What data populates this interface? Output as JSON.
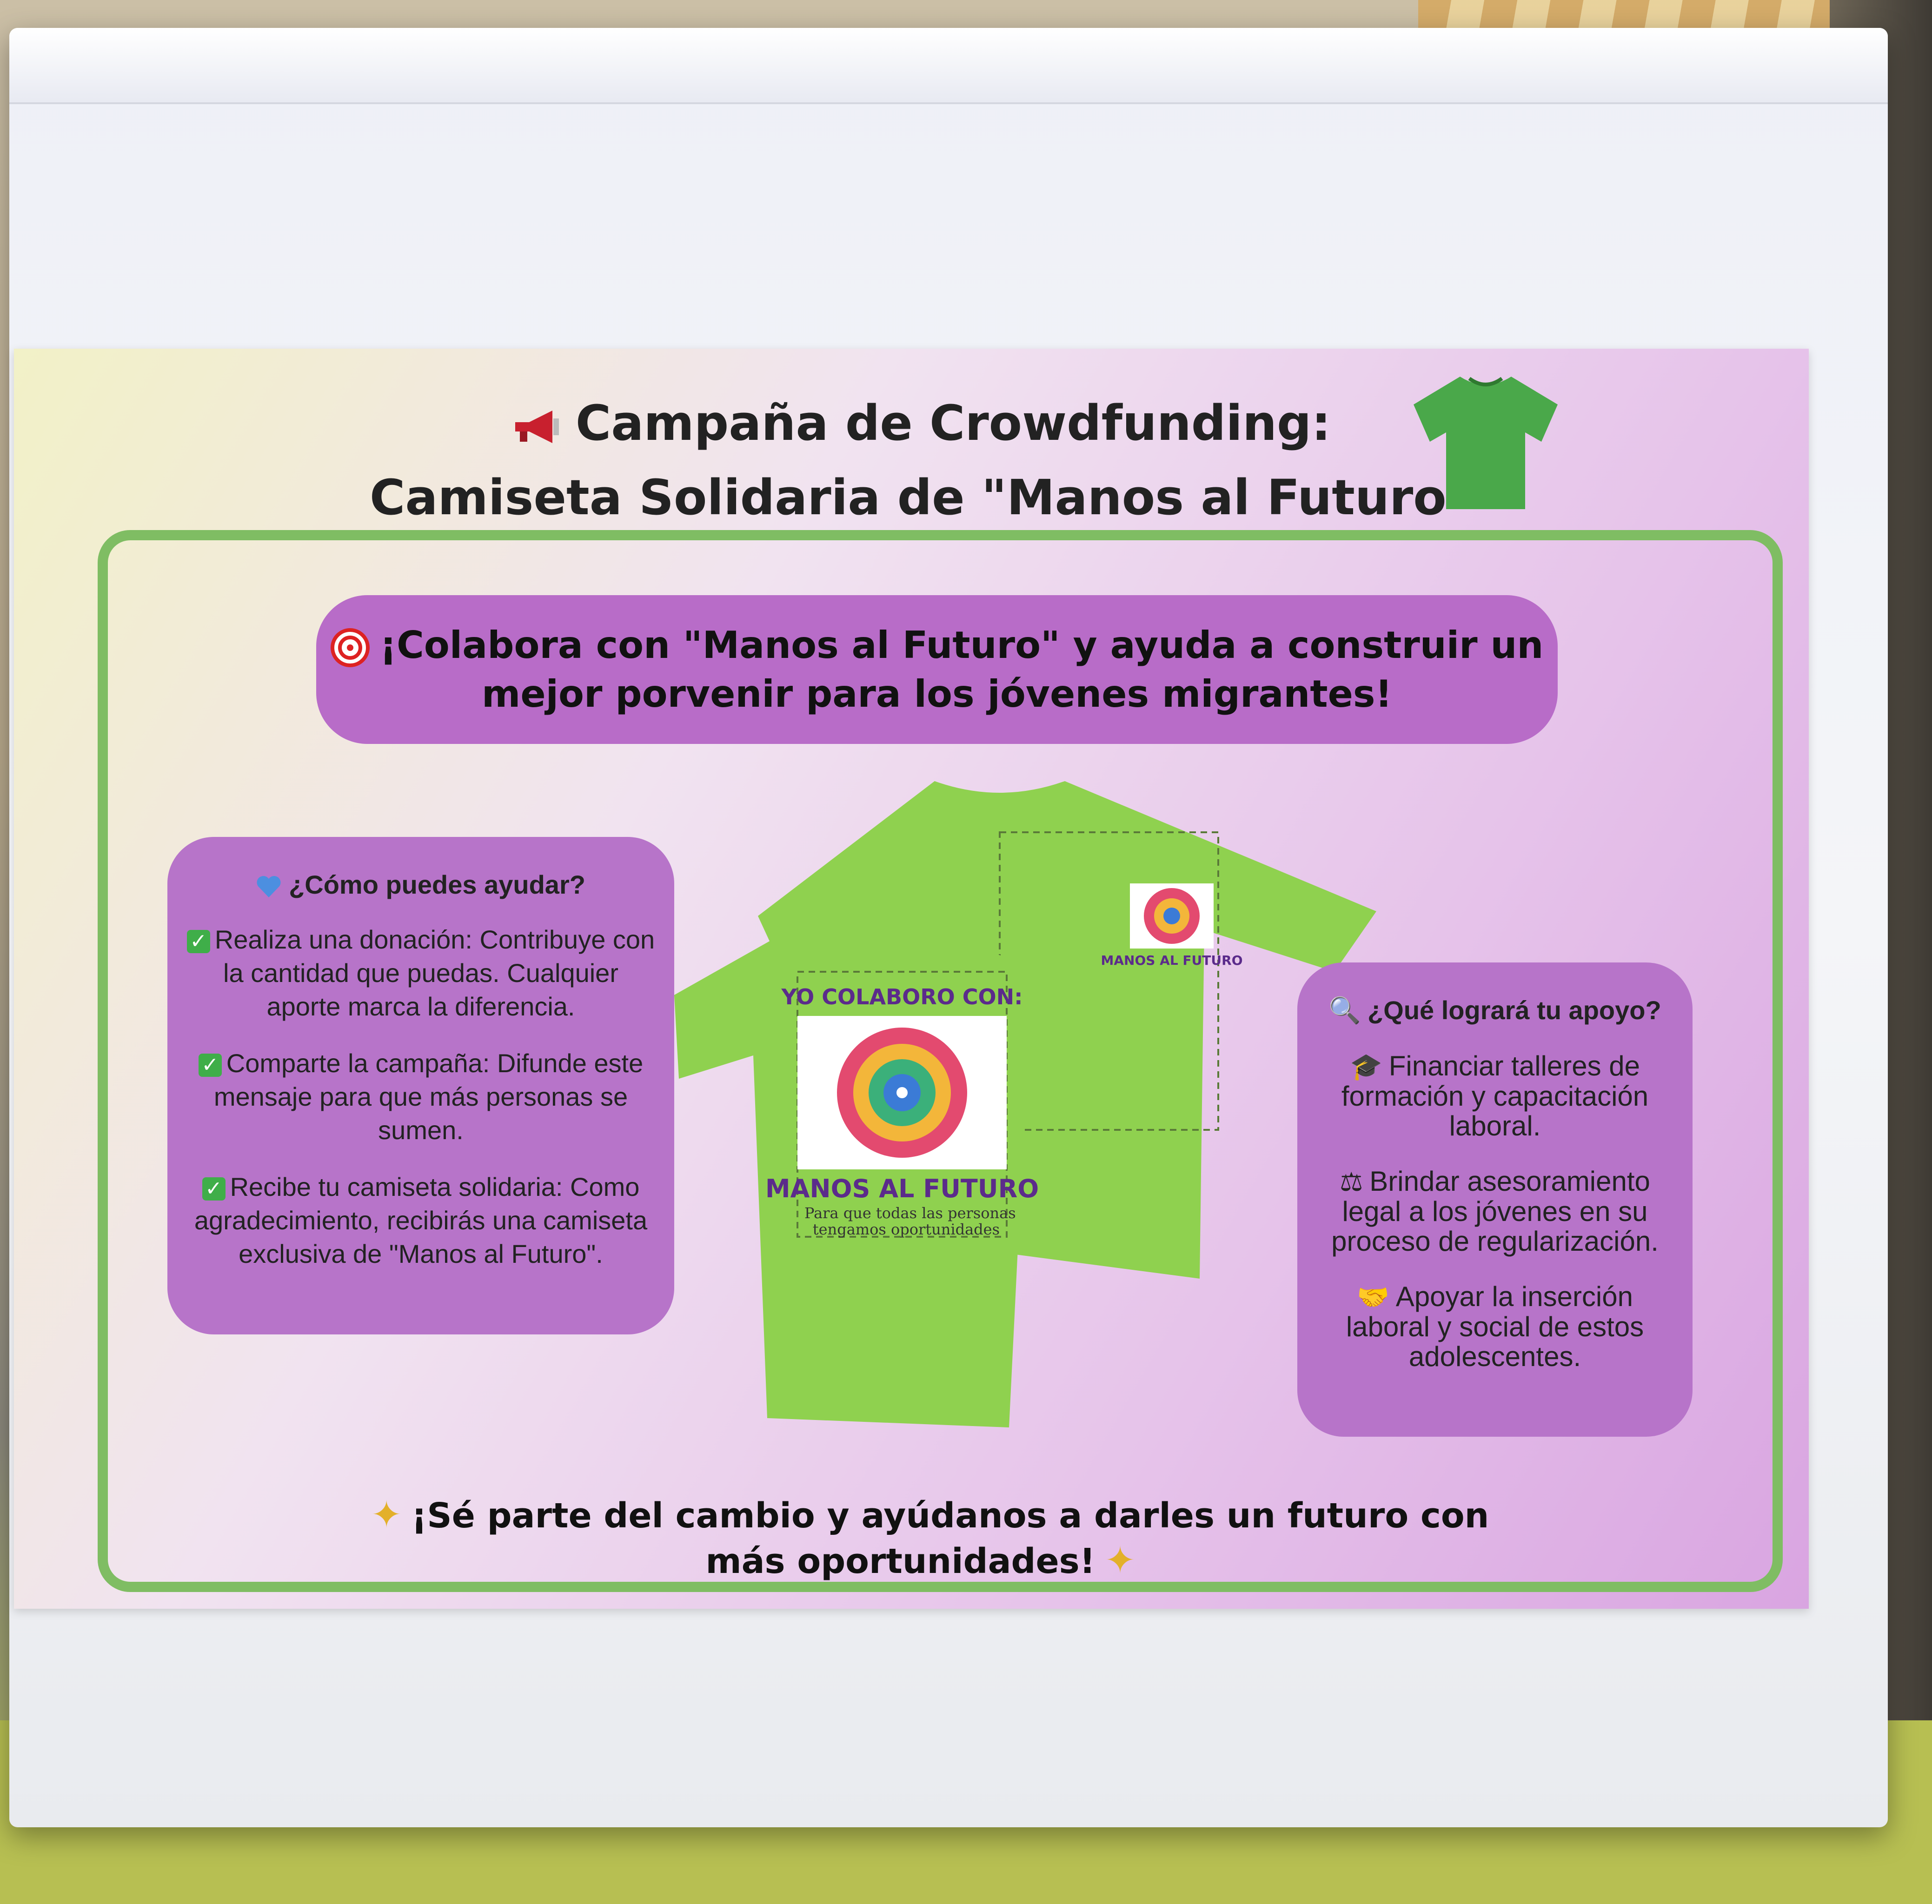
{
  "poster": {
    "title_line1": "Campaña de Crowdfunding:",
    "title_line2": "Camiseta Solidaria de \"Manos al Futuro\"",
    "banner_line1": "¡Colabora con \"Manos al Futuro\" y ayuda a construir un",
    "banner_line2": "mejor porvenir para los jóvenes migrantes!",
    "help_card": {
      "title": "¿Cómo puedes ayudar?",
      "items": [
        "Realiza una donación: Contribuye con la cantidad que puedas. Cualquier aporte marca la diferencia.",
        "Comparte la campaña: Difunde este mensaje para que más personas se sumen.",
        "Recibe tu camiseta solidaria: Como agradecimiento, recibirás una camiseta exclusiva de \"Manos al Futuro\"."
      ]
    },
    "impact_card": {
      "title": "¿Qué logrará tu apoyo?",
      "items": [
        "Financiar talleres de formación y capacitación laboral.",
        "Brindar asesoramiento legal a los jóvenes en su proceso de regularización.",
        "Apoyar la inserción laboral y social de estos adolescentes."
      ]
    },
    "shirt_back_header": "YO COLABORO CON:",
    "shirt_back_brand": "MANOS AL FUTURO",
    "shirt_back_tagline_1": "Para que todas las personas",
    "shirt_back_tagline_2": "tengamos oportunidades",
    "shirt_front_brand": "MANOS AL FUTURO",
    "footer_line1": "¡Sé parte del cambio y ayúdanos a darles un futuro con",
    "footer_line2": "más oportunidades!"
  },
  "colors": {
    "frame": "#7fbd63",
    "card": "#b774c9",
    "shirt": "#8fd14f",
    "title_tee": "#4aa84a"
  },
  "icons": [
    "megaphone-icon",
    "tshirt-icon",
    "target-icon",
    "heart-icon",
    "check-icon",
    "magnifier-icon",
    "graduation-cap-icon",
    "scales-icon",
    "handshake-icon",
    "sparkle-icon"
  ]
}
